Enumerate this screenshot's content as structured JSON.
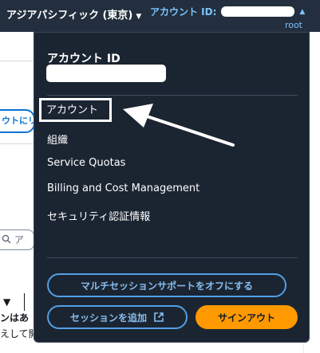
{
  "topbar": {
    "region_label": "アジアパシフィック (東京)",
    "account_label": "アカウント ID:",
    "user_role": "root"
  },
  "background": {
    "button_fragment": "ウトにリ",
    "search_fragment": "ア",
    "text_fragment_1": "ンはあ",
    "text_fragment_2": "えして開"
  },
  "menu": {
    "account_id_heading": "アカウント ID",
    "items": [
      {
        "label": "アカウント"
      },
      {
        "label": "組織"
      },
      {
        "label": "Service Quotas"
      },
      {
        "label": "Billing and Cost Management"
      },
      {
        "label": "セキュリティ認証情報"
      }
    ],
    "multi_session_button": "マルチセッションサポートをオフにする",
    "add_session_button": "セッションを追加",
    "sign_out_button": "サインアウト"
  },
  "colors": {
    "topbar_bg": "#232f3e",
    "panel_bg": "#1b2532",
    "accent_blue": "#539fe5",
    "sign_out_orange": "#ff9900"
  },
  "icons": {
    "external_link": "external-link-icon",
    "caret": "caret-down-icon",
    "annotation_arrow": "annotation-arrow-icon"
  }
}
